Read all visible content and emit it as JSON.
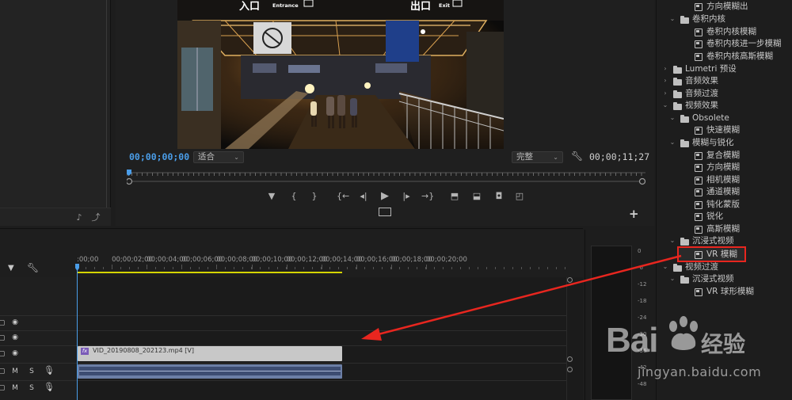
{
  "program_monitor": {
    "sign_entrance_cn": "入口",
    "sign_entrance_en": "Entrance",
    "sign_exit_cn": "出口",
    "sign_exit_en": "Exit",
    "current_timecode": "00;00;00;00",
    "fit_dropdown": "适合",
    "quality_dropdown": "完整",
    "duration_timecode": "00;00;11;27",
    "accent_color": "#4a9de8"
  },
  "effects_tree": [
    {
      "label": "方向模糊出",
      "icon": "transition-icon",
      "selected": false
    },
    {
      "label": "卷积内核",
      "icon": "folder-icon",
      "selected": false
    },
    {
      "label": "卷积内核模糊",
      "icon": "transition-icon",
      "selected": false
    },
    {
      "label": "卷积内核进一步模糊",
      "icon": "transition-icon",
      "selected": false
    },
    {
      "label": "卷积内核高斯模糊",
      "icon": "transition-icon",
      "selected": false
    },
    {
      "label": "Lumetri 预设",
      "icon": "folder-icon",
      "selected": false
    },
    {
      "label": "音频效果",
      "icon": "folder-icon",
      "selected": false
    },
    {
      "label": "音频过渡",
      "icon": "folder-icon",
      "selected": false
    },
    {
      "label": "视频效果",
      "icon": "folder-icon",
      "selected": false
    },
    {
      "label": "Obsolete",
      "icon": "folder-icon",
      "selected": false
    },
    {
      "label": "快速模糊",
      "icon": "fx-icon",
      "selected": false
    },
    {
      "label": "模糊与锐化",
      "icon": "folder-icon",
      "selected": false
    },
    {
      "label": "复合模糊",
      "icon": "fx-icon",
      "selected": false
    },
    {
      "label": "方向模糊",
      "icon": "fx-icon",
      "selected": false
    },
    {
      "label": "相机模糊",
      "icon": "fx-icon",
      "selected": false
    },
    {
      "label": "通道模糊",
      "icon": "fx-icon",
      "selected": false
    },
    {
      "label": "钝化蒙版",
      "icon": "fx-icon",
      "selected": false
    },
    {
      "label": "锐化",
      "icon": "fx-icon",
      "selected": false
    },
    {
      "label": "高斯模糊",
      "icon": "fx-icon",
      "selected": false
    },
    {
      "label": "沉浸式视频",
      "icon": "folder-icon",
      "selected": false
    },
    {
      "label": "VR 模糊",
      "icon": "fx-icon",
      "selected": true
    },
    {
      "label": "视频过渡",
      "icon": "folder-icon",
      "selected": false
    },
    {
      "label": "沉浸式视频",
      "icon": "folder-icon",
      "selected": false
    },
    {
      "label": "VR 球形模糊",
      "icon": "transition-icon",
      "selected": false
    }
  ],
  "timeline": {
    "ruler_labels": [
      ":00;00",
      "00;00;02;00",
      "00;00;04;00",
      "00;00;06;00",
      "00;00;08;00",
      "00;00;10;00",
      "00;00;12;00",
      "00;00;14;00",
      "00;00;16;00",
      "00;00;18;00",
      "00;00;20;00"
    ],
    "clip_name": "VID_20190808_202123.mp4 [V]",
    "fx_badge": "fx",
    "track_mute": "M",
    "track_solo": "S",
    "playhead_color": "#4a9de8",
    "work_area_color": "#d4d400",
    "selection_box_color": "#e8261f",
    "arrow_color": "#e8261f"
  },
  "audio_meter": {
    "scale": [
      "0",
      "-6",
      "-12",
      "-18",
      "-24",
      "-30",
      "-36",
      "-42",
      "-48"
    ]
  },
  "watermark": {
    "logo_left": "Bai",
    "logo_right": "经验",
    "url": "jingyan.baidu.com"
  }
}
